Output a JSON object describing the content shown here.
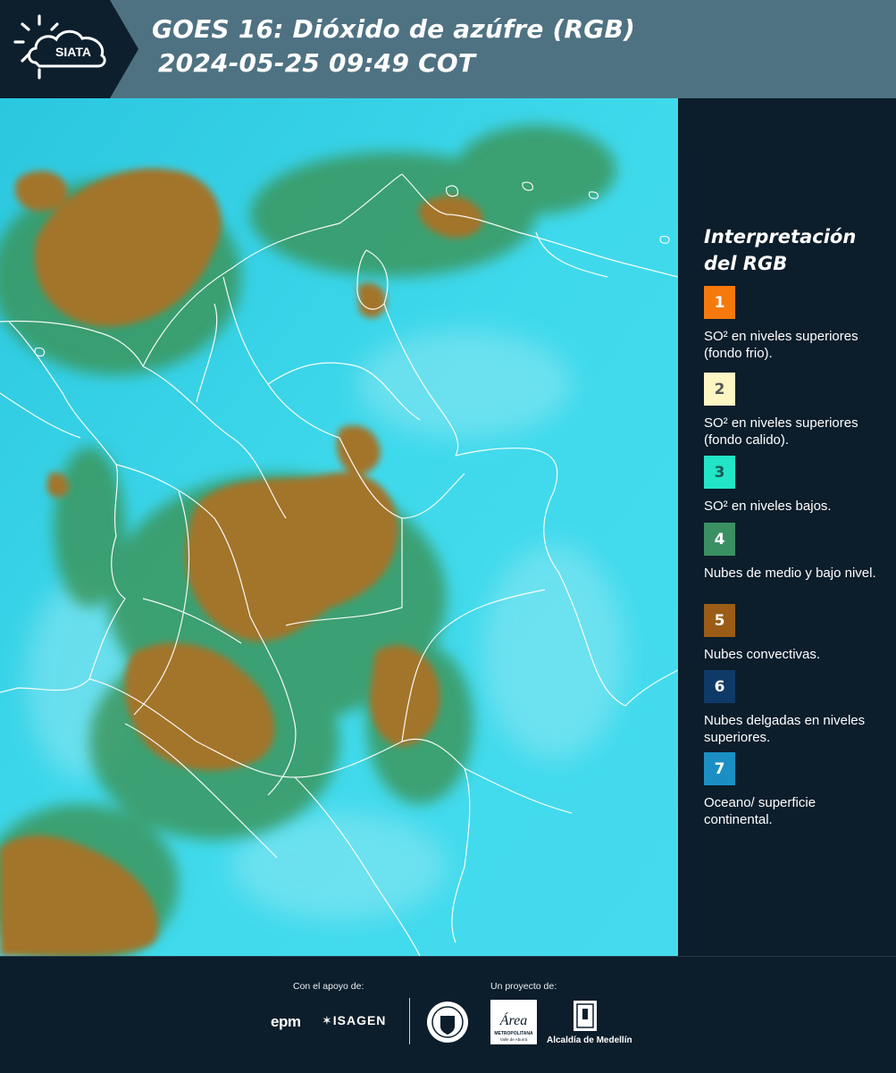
{
  "header": {
    "logo_text": "SIATA",
    "title_line1": "GOES 16: Dióxido de azúfre (RGB)",
    "title_line2": "2024-05-25 09:49 COT"
  },
  "map": {
    "icon": "satellite-rgb-map",
    "colors": {
      "background": "#38d6ea",
      "convective": "#a5772d",
      "mid_low_clouds": "#3f8f4e",
      "borders": "#ffffff"
    }
  },
  "legend": {
    "title": "Interpretación del RGB",
    "items": [
      {
        "number": "1",
        "color": "#f5790c",
        "text_color": "#ffffff",
        "label": "SO² en niveles superiores (fondo frio)."
      },
      {
        "number": "2",
        "color": "#fdf6c3",
        "text_color": "#555555",
        "label": "SO² en niveles superiores (fondo calido)."
      },
      {
        "number": "3",
        "color": "#22e4c6",
        "text_color": "#1b5a58",
        "label": "SO² en niveles bajos."
      },
      {
        "number": "4",
        "color": "#3a9062",
        "text_color": "#ffffff",
        "label": "Nubes de medio y bajo nivel."
      },
      {
        "number": "5",
        "color": "#9a5c16",
        "text_color": "#ffffff",
        "label": "Nubes convectivas."
      },
      {
        "number": "6",
        "color": "#0f3a67",
        "text_color": "#ffffff",
        "label": "Nubes delgadas en niveles superiores."
      },
      {
        "number": "7",
        "color": "#1b8fc4",
        "text_color": "#ffffff",
        "label": "Oceano/ superficie continental."
      }
    ]
  },
  "footer": {
    "support_label": "Con el apoyo de:",
    "project_label": "Un proyecto de:",
    "epm": "epm",
    "isagen": "ISAGEN",
    "metro": "Área",
    "metro_sub1": "METROPOLITANA",
    "metro_sub2": "Valle de Aburrá",
    "alcaldia": "Alcaldía de Medellín"
  }
}
